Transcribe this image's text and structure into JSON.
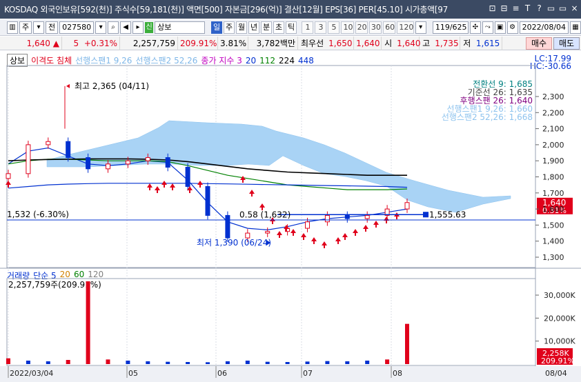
{
  "title": "KOSDAQ 외국인보유[592(천)] 주식수[59,181(천)] 액면[500] 자본금[296(억)] 결산[12월] EPS[36] PER[45.10] 시가총액[97",
  "title_buttons": [
    "⊡",
    "⊟",
    "≡",
    "T",
    "?",
    "▭",
    "▭",
    "×"
  ],
  "toolbar1": {
    "market": "주",
    "prev": "전",
    "code": "027580",
    "name": "상보",
    "credit_tag": "신",
    "periods": [
      "일",
      "주",
      "월",
      "년",
      "분",
      "초",
      "틱"
    ],
    "active_period": "일",
    "numbers": [
      "1",
      "3",
      "5",
      "10",
      "20",
      "30",
      "60",
      "120"
    ],
    "count": "119/625",
    "date": "2022/08/04"
  },
  "toolbar2": {
    "price": "1,640",
    "change": "5",
    "change_pct": "+0.31%",
    "volume": "2,257,759",
    "vol_ratio": "209.91%",
    "turnover": "3.81%",
    "trade_value": "3,782백만",
    "best_bid_label": "최우선",
    "best_ask": "1,650",
    "best_bid": "1,640",
    "open_label": "시",
    "open": "1,640",
    "high_label": "고",
    "high": "1,735",
    "low_label": "저",
    "low": "1,615",
    "buy": "매수",
    "sell": "매도"
  },
  "price_panel": {
    "name_tag": "상보",
    "legend": [
      {
        "text": "이격도 침체",
        "color": "#e0001b"
      },
      {
        "text": "선행스팬1 9,26",
        "color": "#7fb7e8"
      },
      {
        "text": "선행스팬2 52,26",
        "color": "#7fb7e8"
      },
      {
        "text": "종가 지수 3",
        "color": "#c000c0"
      },
      {
        "text": "20",
        "color": "#0030d0"
      },
      {
        "text": "112",
        "color": "#008000"
      },
      {
        "text": "224",
        "color": "#000000"
      },
      {
        "text": "448",
        "color": "#0030d0"
      }
    ],
    "lc": "LC:17.99",
    "hc": "HC:-30.66",
    "ichimoku_labels": [
      {
        "text": "전환선 9: 1,685",
        "color": "#008080"
      },
      {
        "text": "기준선 26: 1,635",
        "color": "#404040"
      },
      {
        "text": "후행스팬 26: 1,640",
        "color": "#800080"
      },
      {
        "text": "선행스팬1 9,26: 1,660",
        "color": "#8ec3ee"
      },
      {
        "text": "선행스팬2 52,26: 1,668",
        "color": "#8ec3ee"
      }
    ],
    "annotations": {
      "high": "최고 2,365 (04/11)",
      "low": "최저 1,390 (06/24)",
      "level": "1,532 (-6.30%)",
      "line_left": "0.58 (1,632)",
      "line_right": "1,555.63"
    },
    "price_ticks": [
      "2,300",
      "2,200",
      "2,100",
      "2,000",
      "1,900",
      "1,800",
      "1,700",
      "1,600",
      "1,500",
      "1,400",
      "1,300"
    ],
    "current_price": "1,640",
    "current_pct": "0.31%"
  },
  "volume_panel": {
    "legend": [
      {
        "text": "거래량",
        "color": "#0030d0"
      },
      {
        "text": "단순 5",
        "color": "#0030d0"
      },
      {
        "text": "20",
        "color": "#d08000"
      },
      {
        "text": "60",
        "color": "#008000"
      },
      {
        "text": "120",
        "color": "#808080"
      }
    ],
    "volume_info": "2,257,759주(209.91%)",
    "vol_ticks": [
      "30,000K",
      "20,000K",
      "10,000K"
    ],
    "current_vol": "2,258K",
    "current_vol_pct": "209.91%"
  },
  "x_axis": {
    "labels": [
      "2022/03/04",
      "05",
      "06",
      "07",
      "08"
    ],
    "right_label": "08/04"
  },
  "colors": {
    "up": "#e0001b",
    "down": "#0030d0",
    "cloud": "#a9d3f5",
    "titlebar": "#3b4a63"
  },
  "chart_data": {
    "type": "candlestick",
    "x": [
      "2022/03/04",
      "05",
      "06",
      "07",
      "08/04"
    ],
    "series": [
      {
        "name": "종가",
        "values": [
          1820,
          2000,
          2020,
          1920,
          1850,
          1880,
          1900,
          1920,
          1860,
          1740,
          1560,
          1420,
          1450,
          1460,
          1480,
          1520,
          1560,
          1540,
          1560,
          1600,
          1640
        ]
      },
      {
        "name": "20",
        "values": [
          1880,
          1960,
          1980,
          1930,
          1880,
          1870,
          1880,
          1900,
          1890,
          1780,
          1640,
          1520,
          1480,
          1470,
          1490,
          1520,
          1540,
          1550,
          1560,
          1580,
          1600
        ]
      },
      {
        "name": "112",
        "values": [
          1880,
          1900,
          1910,
          1910,
          1905,
          1900,
          1900,
          1900,
          1895,
          1870,
          1840,
          1810,
          1790,
          1770,
          1750,
          1740,
          1730,
          1720,
          1720,
          1720,
          1725
        ]
      },
      {
        "name": "224",
        "values": [
          1900,
          1905,
          1908,
          1910,
          1912,
          1912,
          1912,
          1910,
          1905,
          1895,
          1880,
          1865,
          1850,
          1840,
          1830,
          1825,
          1820,
          1815,
          1810,
          1810,
          1810
        ]
      },
      {
        "name": "448",
        "values": [
          1730,
          1740,
          1750,
          1755,
          1758,
          1760,
          1760,
          1760,
          1760,
          1760,
          1758,
          1756,
          1754,
          1752,
          1750,
          1748,
          1746,
          1744,
          1742,
          1740,
          1735
        ]
      }
    ],
    "volume": [
      2500,
      1500,
      1200,
      1800,
      36000,
      2000,
      1500,
      1200,
      1000,
      900,
      800,
      1200,
      1500,
      1000,
      900,
      1100,
      1300,
      1200,
      1500,
      2000,
      17500
    ],
    "ylim": [
      1300,
      2360
    ],
    "vol_ylim": [
      0,
      36000
    ]
  }
}
